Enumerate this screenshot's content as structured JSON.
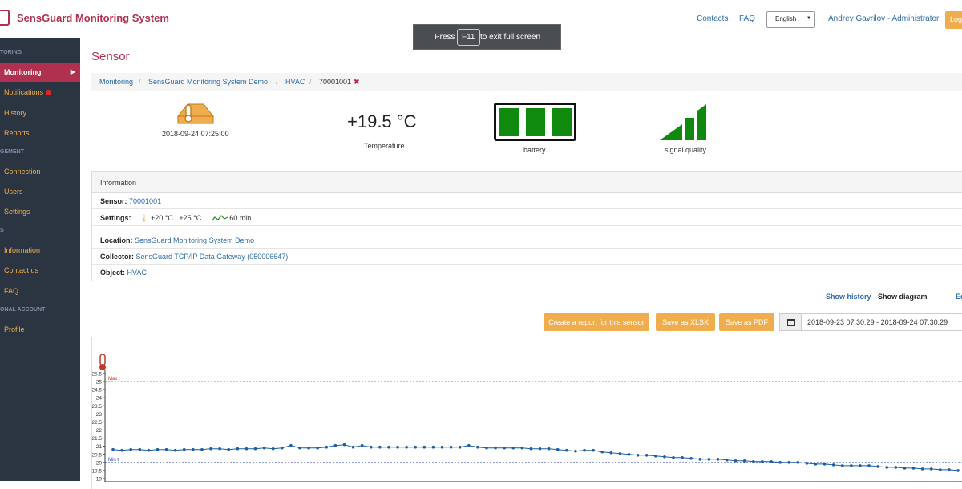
{
  "header": {
    "app_title": "SensGuard Monitoring System",
    "contacts": "Contacts",
    "faq": "FAQ",
    "language": "English",
    "user": "Andrey Gavrilov - Administrator",
    "logout": "Log"
  },
  "toast": {
    "press": "Press",
    "key": "F11",
    "rest": "to exit full screen"
  },
  "sidebar": {
    "sections": [
      "TORING",
      "GEMENT",
      "S",
      "ONAL ACCOUNT"
    ],
    "items": [
      {
        "label": "Monitoring"
      },
      {
        "label": "Notifications"
      },
      {
        "label": "History"
      },
      {
        "label": "Reports"
      },
      {
        "label": "Connection"
      },
      {
        "label": "Users"
      },
      {
        "label": "Settings"
      },
      {
        "label": "Information"
      },
      {
        "label": "Contact us"
      },
      {
        "label": "FAQ"
      },
      {
        "label": "Profile"
      }
    ]
  },
  "page": {
    "title": "Sensor"
  },
  "breadcrumb": [
    "Monitoring",
    "SensGuard Monitoring System Demo",
    "HVAC",
    "70001001"
  ],
  "status": {
    "timestamp": "2018-09-24 07:25:00",
    "temperature": "+19.5 °C",
    "temperature_label": "Temperature",
    "battery_label": "battery",
    "battery_level": 3,
    "signal_label": "signal quality",
    "signal_level": 3
  },
  "info": {
    "heading": "Information",
    "sensor_label": "Sensor:",
    "sensor_value": "70001001",
    "settings_label": "Settings:",
    "settings_range": "+20 °C...+25 °C",
    "settings_interval": "60 min",
    "location_label": "Location:",
    "location_value": "SensGuard Monitoring System Demo",
    "collector_label": "Collector:",
    "collector_value": "SensGuard TCP/IP Data Gateway (050006647)",
    "object_label": "Object:",
    "object_value": "HVAC"
  },
  "actions": {
    "show_history": "Show history",
    "show_diagram": "Show diagram",
    "edit": "Ed",
    "report_btn": "Create a report for this sensor",
    "xlsx_btn": "Save as XLSX",
    "pdf_btn": "Save as PDF",
    "date_range": "2018-09-23 07:30:29 - 2018-09-24 07:30:29"
  },
  "colors": {
    "brand": "#b03050",
    "accent": "#f0ad4e",
    "link": "#2e6aa5",
    "series": "#1f5f9f",
    "good": "#0f8a0f"
  },
  "chart_data": {
    "type": "line",
    "y_ticks": [
      "25.5",
      "25",
      "24.5",
      "24",
      "23.5",
      "23",
      "22.5",
      "22",
      "21.5",
      "21",
      "20.5",
      "20",
      "19.5",
      "19"
    ],
    "ylim": [
      19,
      25.5
    ],
    "max_label": "Max t",
    "max_value": 25,
    "min_label": "Min t",
    "min_value": 20,
    "series": [
      {
        "values": [
          20.8,
          20.75,
          20.8,
          20.8,
          20.75,
          20.8,
          20.8,
          20.75,
          20.8,
          20.8,
          20.8,
          20.85,
          20.85,
          20.8,
          20.85,
          20.85,
          20.85,
          20.9,
          20.85,
          20.9,
          21.05,
          20.9,
          20.9,
          20.9,
          20.95,
          21.05,
          21.1,
          20.95,
          21.05,
          20.95,
          20.95,
          20.95,
          20.95,
          20.95,
          20.95,
          20.95,
          20.95,
          20.95,
          20.95,
          20.95,
          21.05,
          20.95,
          20.9,
          20.9,
          20.9,
          20.9,
          20.9,
          20.85,
          20.85,
          20.85,
          20.8,
          20.75,
          20.7,
          20.75,
          20.75,
          20.65,
          20.6,
          20.55,
          20.5,
          20.45,
          20.45,
          20.4,
          20.35,
          20.3,
          20.3,
          20.25,
          20.2,
          20.2,
          20.2,
          20.15,
          20.1,
          20.1,
          20.05,
          20.05,
          20.05,
          20,
          20,
          20,
          19.95,
          19.9,
          19.9,
          19.85,
          19.8,
          19.8,
          19.8,
          19.8,
          19.75,
          19.7,
          19.7,
          19.65,
          19.65,
          19.6,
          19.6,
          19.55,
          19.55,
          19.5
        ]
      }
    ]
  }
}
